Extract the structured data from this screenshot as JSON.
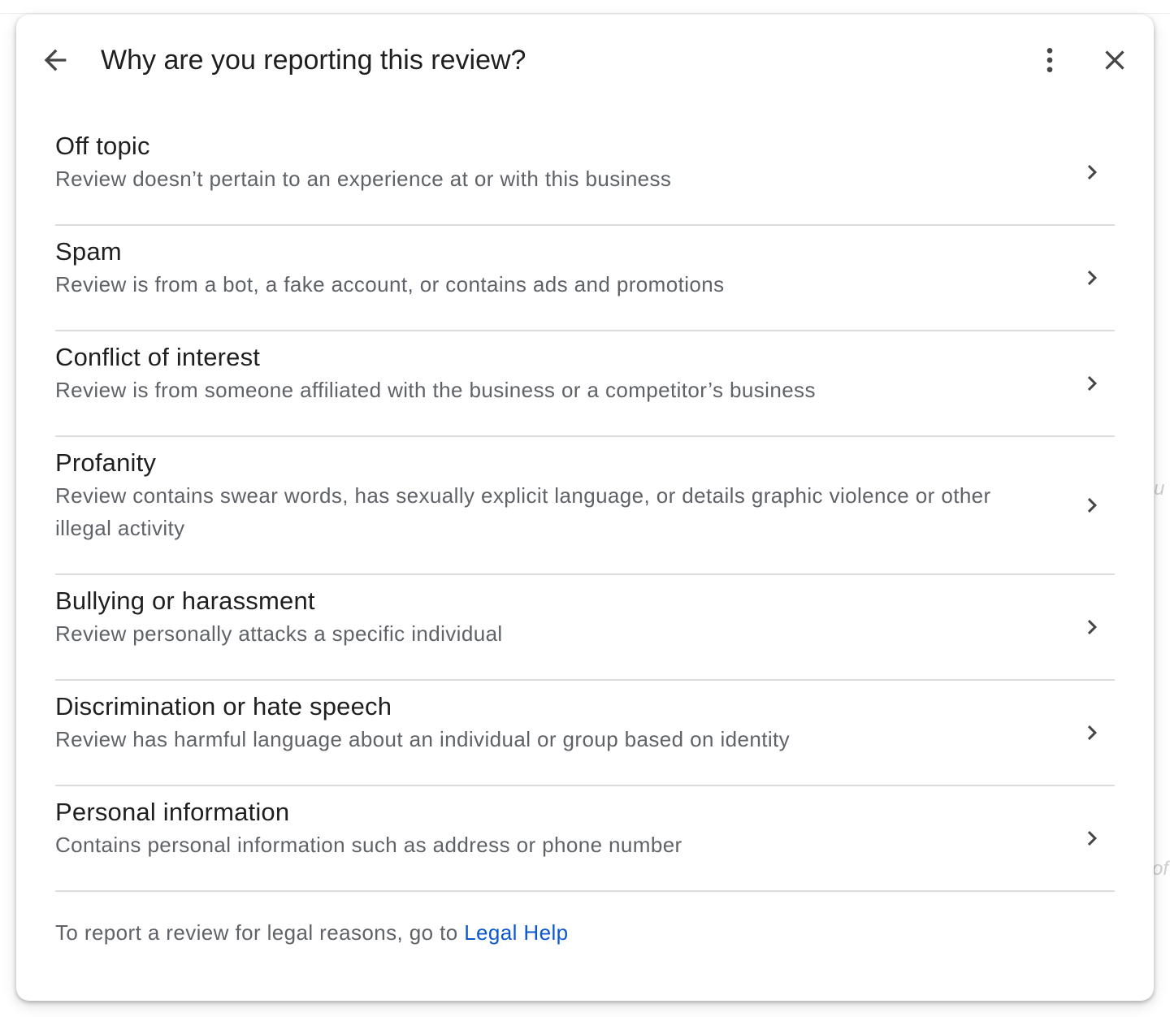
{
  "dialog": {
    "title": "Why are you reporting this review?",
    "back_icon": "arrow-back-icon",
    "more_icon": "more-vert-icon",
    "close_icon": "close-icon"
  },
  "reasons": [
    {
      "label": "Off topic",
      "description": "Review doesn’t pertain to an experience at or with this business"
    },
    {
      "label": "Spam",
      "description": "Review is from a bot, a fake account, or contains ads and promotions"
    },
    {
      "label": "Conflict of interest",
      "description": "Review is from someone affiliated with the business or a competitor’s business"
    },
    {
      "label": "Profanity",
      "description": "Review contains swear words, has sexually explicit language, or details graphic violence or other illegal activity"
    },
    {
      "label": "Bullying or harassment",
      "description": "Review personally attacks a specific individual"
    },
    {
      "label": "Discrimination or hate speech",
      "description": "Review has harmful language about an individual or group based on identity"
    },
    {
      "label": "Personal information",
      "description": "Contains personal information such as address or phone number"
    }
  ],
  "footer": {
    "text": "To report a review for legal reasons, go to ",
    "link_label": "Legal Help"
  },
  "colors": {
    "text_primary": "#1f1f1f",
    "text_secondary": "#5f6368",
    "link": "#0b57d0",
    "divider": "#dcdcdc"
  },
  "background": {
    "hint1": "u",
    "hint2": "of"
  }
}
